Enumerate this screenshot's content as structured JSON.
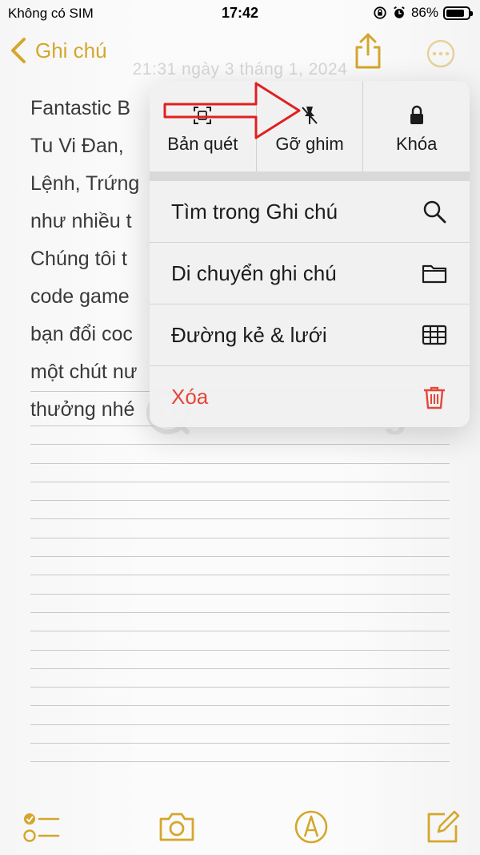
{
  "status": {
    "carrier": "Không có SIM",
    "time": "17:42",
    "battery": "86%",
    "battery_level": 0.86
  },
  "nav": {
    "back_label": "Ghi chú",
    "date": "21:31 ngày 3 tháng 1, 2024"
  },
  "note": {
    "lines": [
      "Fantastic B",
      "Tu Vi Đan,",
      "Lệnh, Trứng",
      "như nhiều t",
      "Chúng tôi t",
      "code game",
      "bạn đổi coc",
      "một chút nư",
      "thưởng nhé"
    ]
  },
  "menu": {
    "top_items": [
      {
        "label": "Bản quét",
        "icon": "scan-icon"
      },
      {
        "label": "Gỡ ghim",
        "icon": "unpin-icon"
      },
      {
        "label": "Khóa",
        "icon": "lock-icon"
      }
    ],
    "rows": [
      {
        "label": "Tìm trong Ghi chú",
        "icon": "search-icon"
      },
      {
        "label": "Di chuyển ghi chú",
        "icon": "folder-icon"
      },
      {
        "label": "Đường kẻ & lưới",
        "icon": "grid-icon"
      },
      {
        "label": "Xóa",
        "icon": "trash-icon"
      }
    ]
  },
  "watermark": {
    "text": "uantrimang"
  },
  "colors": {
    "accent": "#d4a72c",
    "danger": "#e6453a",
    "annotation": "#e02020"
  }
}
